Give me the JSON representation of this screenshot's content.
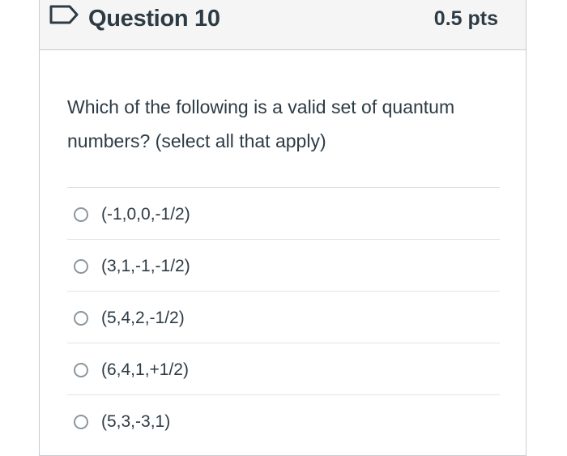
{
  "question": {
    "title": "Question 10",
    "points": "0.5 pts",
    "text": "Which of the following is a valid set of quantum numbers? (select all that apply)",
    "flag_icon": "flag-outline-icon"
  },
  "answers": [
    {
      "label": "(-1,0,0,-1/2)",
      "checked": false
    },
    {
      "label": "(3,1,-1,-1/2)",
      "checked": false
    },
    {
      "label": "(5,4,2,-1/2)",
      "checked": false
    },
    {
      "label": "(6,4,1,+1/2)",
      "checked": false
    },
    {
      "label": "(5,3,-3,1)",
      "checked": false
    }
  ],
  "colors": {
    "text": "#2d3b45",
    "border": "#c7cdd1",
    "header_bg": "#f5f5f5",
    "flag": "#2d3b45",
    "checkbox_border": "#8b969e"
  }
}
